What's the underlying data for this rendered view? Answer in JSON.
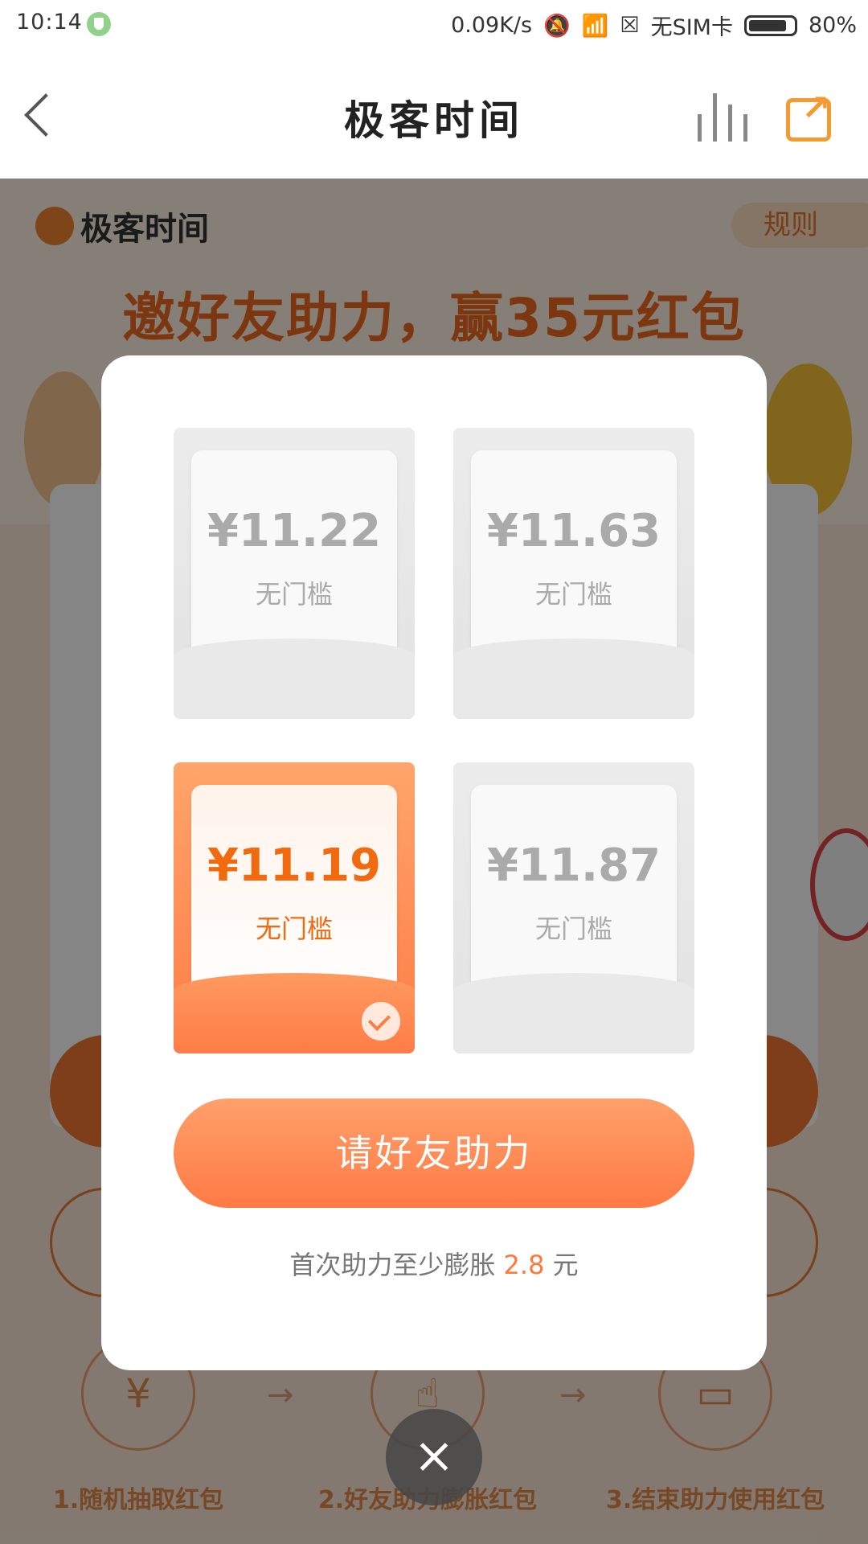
{
  "status_bar": {
    "time": "10:14",
    "network_speed": "0.09K/s",
    "sim": "无SIM卡",
    "battery": "80%"
  },
  "app_bar": {
    "title": "极客时间"
  },
  "background": {
    "logo_text": "极客时间",
    "rule_button": "规则",
    "headline": "邀好友助力，赢35元红包",
    "steps": [
      {
        "icon": "¥",
        "label": "1.随机抽取红包"
      },
      {
        "icon": "☝",
        "label": "2.好友助力膨胀红包"
      },
      {
        "icon": "▭",
        "label": "3.结束助力使用红包"
      }
    ]
  },
  "modal": {
    "coupons": [
      {
        "amount": "¥11.22",
        "condition": "无门槛",
        "selected": false
      },
      {
        "amount": "¥11.63",
        "condition": "无门槛",
        "selected": false
      },
      {
        "amount": "¥11.19",
        "condition": "无门槛",
        "selected": true
      },
      {
        "amount": "¥11.87",
        "condition": "无门槛",
        "selected": false
      }
    ],
    "cta_label": "请好友助力",
    "note_prefix": "首次助力至少膨胀",
    "note_value": "2.8",
    "note_suffix": "元"
  },
  "colors": {
    "accent": "#ff7a45",
    "share_icon": "#f39a32"
  }
}
